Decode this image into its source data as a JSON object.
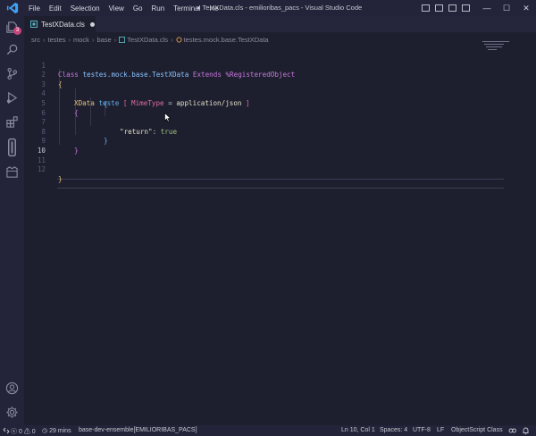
{
  "titlebar": {
    "menu": [
      "File",
      "Edit",
      "Selection",
      "View",
      "Go",
      "Run",
      "Terminal",
      "He"
    ],
    "title": "● TestXData.cls - emilioribas_pacs - Visual Studio Code",
    "controls": {
      "minimize": "—",
      "maximize": "☐",
      "close": "✕"
    }
  },
  "activity": {
    "explorer_badge": "3"
  },
  "tab": {
    "filename": "TestXData.cls"
  },
  "breadcrumb": [
    "src",
    "testes",
    "mock",
    "base",
    "TestXData.cls",
    "testes.mock.base.TestXData"
  ],
  "editor": {
    "line_numbers": [
      "1",
      "2",
      "3",
      "4",
      "5",
      "6",
      "7",
      "8",
      "9",
      "10",
      "11",
      "12"
    ],
    "current_line": "10",
    "line1": {
      "kw1": "Class",
      "name": "testes.mock.base.TestXData",
      "kw2": "Extends",
      "parent": "%RegisteredObject"
    },
    "line2": "{",
    "line4": {
      "kw": "XData",
      "name": "teste",
      "open": "[",
      "param": "MimeType",
      "eq": "=",
      "value": "application/json",
      "close": "]"
    },
    "line5": "{",
    "line6": "{",
    "line7": {
      "key": "\"return\"",
      "colon": ":",
      "value": "true"
    },
    "line8": "}",
    "line9": "}",
    "line12": "}"
  },
  "statusbar": {
    "errors": "0",
    "warnings": "0",
    "time": "29 mins",
    "server": "base-dev-ensemble[EMILIORIBAS_PACS]",
    "position": "Ln 10, Col 1",
    "spaces": "Spaces: 4",
    "encoding": "UTF-8",
    "eol": "LF",
    "language": "ObjectScript Class"
  },
  "colors": {
    "background": "#1e1f2e",
    "activity_bar": "#23243a",
    "badge": "#c9447a",
    "keyword": "#c678dd",
    "class_name": "#89c3ff"
  }
}
